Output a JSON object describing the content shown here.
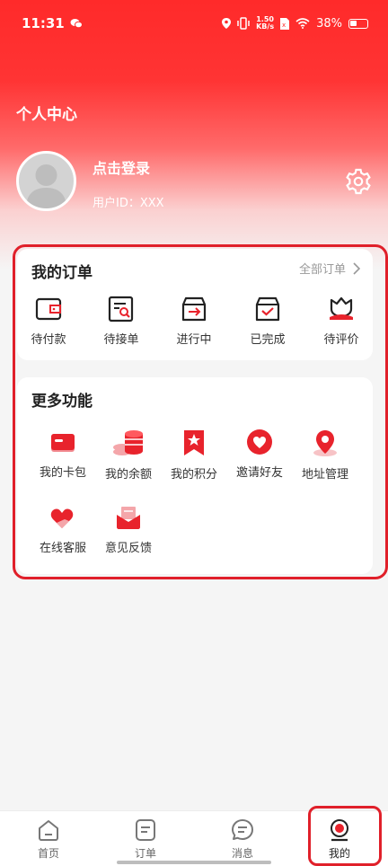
{
  "status": {
    "time": "11:31",
    "net_speed_value": "1.50",
    "net_speed_unit": "KB/s",
    "battery": "38%"
  },
  "header": {
    "title": "个人中心",
    "login_label": "点击登录",
    "user_id": "用户ID：XXX"
  },
  "orders": {
    "title": "我的订单",
    "all_label": "全部订单",
    "items": [
      {
        "label": "待付款",
        "icon": "wallet-icon"
      },
      {
        "label": "待接单",
        "icon": "order-search-icon"
      },
      {
        "label": "进行中",
        "icon": "box-arrow-icon"
      },
      {
        "label": "已完成",
        "icon": "box-check-icon"
      },
      {
        "label": "待评价",
        "icon": "flower-icon"
      }
    ]
  },
  "more": {
    "title": "更多功能",
    "items": [
      {
        "label": "我的卡包",
        "icon": "card-icon"
      },
      {
        "label": "我的余额",
        "icon": "coins-icon"
      },
      {
        "label": "我的积分",
        "icon": "star-flag-icon"
      },
      {
        "label": "邀请好友",
        "icon": "heart-icon"
      },
      {
        "label": "地址管理",
        "icon": "location-pin-icon"
      },
      {
        "label": "在线客服",
        "icon": "heart-hand-icon"
      },
      {
        "label": "意见反馈",
        "icon": "mail-icon"
      }
    ]
  },
  "tabs": [
    {
      "label": "首页",
      "icon": "home-icon"
    },
    {
      "label": "订单",
      "icon": "order-icon"
    },
    {
      "label": "消息",
      "icon": "message-icon"
    },
    {
      "label": "我的",
      "icon": "profile-icon"
    }
  ],
  "colors": {
    "accent": "#ff2a2a",
    "icon_red": "#e8232c"
  }
}
